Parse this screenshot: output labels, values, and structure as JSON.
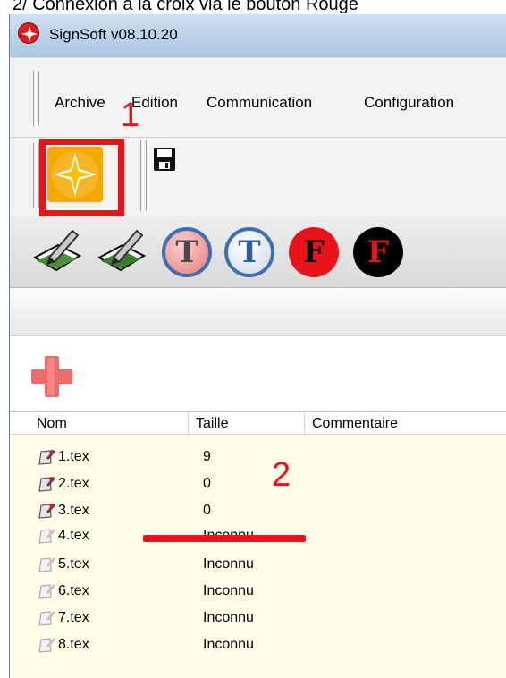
{
  "caption": "2/ Connexion à la croix via le bouton Rouge",
  "window": {
    "title": "SignSoft v08.10.20"
  },
  "menu": {
    "items": [
      "Archive",
      "Edition",
      "Communication",
      "Configuration"
    ]
  },
  "annotations": {
    "marker_1": "1",
    "marker_2": "2",
    "accent_color": "#e8141a"
  },
  "toolbar": {
    "icons": [
      "connect-icon",
      "save-icon"
    ]
  },
  "tools": {
    "items": [
      {
        "name": "edit-sign-icon"
      },
      {
        "name": "edit-sign-icon-2"
      },
      {
        "name": "text-red-icon",
        "letter": "T"
      },
      {
        "name": "text-blue-icon",
        "letter": "T"
      },
      {
        "name": "font-red-icon",
        "letter": "F"
      },
      {
        "name": "font-black-icon",
        "letter": "F"
      }
    ]
  },
  "list": {
    "columns": [
      "Nom",
      "Taille",
      "Commentaire"
    ],
    "rows": [
      {
        "name": "1.tex",
        "size": "9"
      },
      {
        "name": "2.tex",
        "size": "0"
      },
      {
        "name": "3.tex",
        "size": "0"
      },
      {
        "name": "4.tex",
        "size": "Inconnu"
      },
      {
        "name": "5.tex",
        "size": "Inconnu"
      },
      {
        "name": "6.tex",
        "size": "Inconnu"
      },
      {
        "name": "7.tex",
        "size": "Inconnu"
      },
      {
        "name": "8.tex",
        "size": "Inconnu"
      }
    ]
  }
}
